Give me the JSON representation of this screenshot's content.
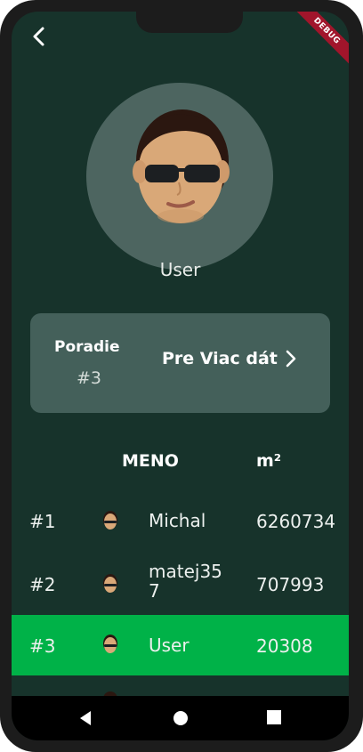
{
  "header": {
    "debug_label": "DEBUG"
  },
  "profile": {
    "name": "User"
  },
  "rank_card": {
    "title": "Poradie",
    "value": "#3",
    "more_button": "Pre Viac dát"
  },
  "table": {
    "col_name": "MENO",
    "col_area": "m²",
    "rows": [
      {
        "rank": "#1",
        "name": "Michal",
        "score": "6260734"
      },
      {
        "rank": "#2",
        "name": "matej357",
        "score": "707993"
      },
      {
        "rank": "#3",
        "name": "User",
        "score": "20308"
      }
    ]
  },
  "colors": {
    "background": "#17332b",
    "card": "#44605a",
    "highlight": "#00b248",
    "debug_banner": "#a1152b"
  }
}
